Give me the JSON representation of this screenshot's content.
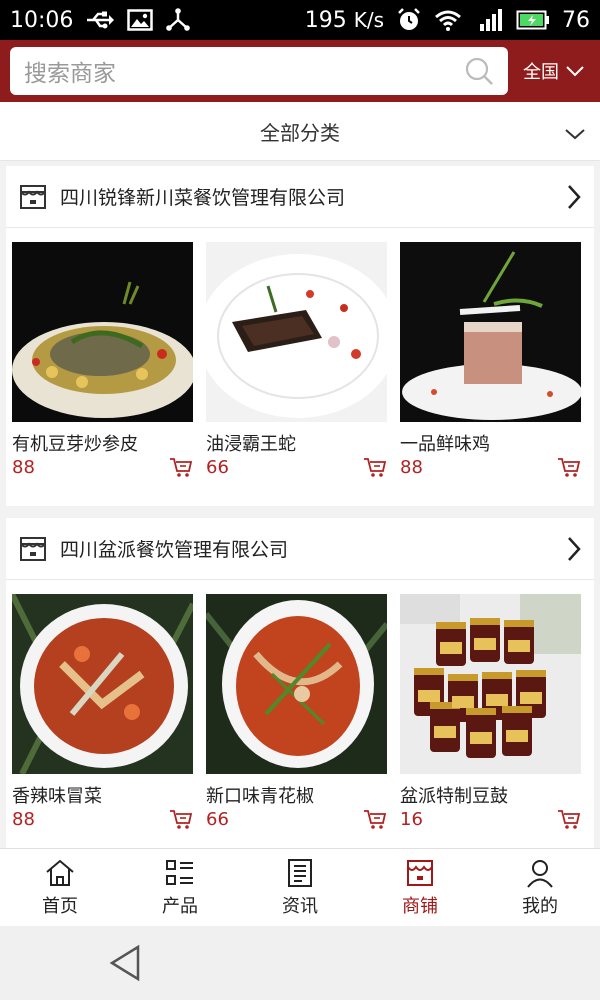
{
  "status_bar": {
    "time": "10:06",
    "net_speed": "195",
    "net_speed_unit": "K/s",
    "battery": "76",
    "icons": [
      "usb-icon",
      "image-icon",
      "share-icon",
      "alarm-icon",
      "wifi-icon",
      "signal-icon",
      "battery-icon"
    ]
  },
  "search": {
    "placeholder": "搜索商家",
    "region": "全国"
  },
  "category": {
    "label": "全部分类"
  },
  "colors": {
    "brand": "#8f1c1c",
    "price": "#b22222",
    "active_nav": "#a01818"
  },
  "shops": [
    {
      "name": "四川锐锋新川菜餐饮管理有限公司",
      "products": [
        {
          "name": "有机豆芽炒参皮",
          "price": "88"
        },
        {
          "name": "油浸霸王蛇",
          "price": "66"
        },
        {
          "name": "一品鲜味鸡",
          "price": "88"
        }
      ]
    },
    {
      "name": "四川盆派餐饮管理有限公司",
      "products": [
        {
          "name": "香辣味冒菜",
          "price": "88"
        },
        {
          "name": "新口味青花椒",
          "price": "66"
        },
        {
          "name": "盆派特制豆鼓",
          "price": "16"
        }
      ]
    }
  ],
  "bottom_nav": [
    {
      "label": "首页",
      "icon": "home-icon"
    },
    {
      "label": "产品",
      "icon": "product-list-icon"
    },
    {
      "label": "资讯",
      "icon": "news-icon"
    },
    {
      "label": "商铺",
      "icon": "store-icon",
      "active": true
    },
    {
      "label": "我的",
      "icon": "profile-icon"
    }
  ]
}
